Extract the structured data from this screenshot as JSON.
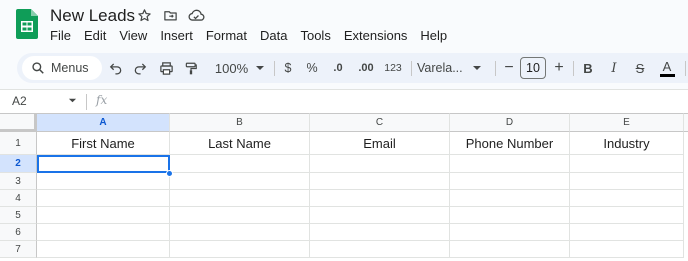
{
  "app": {
    "doc_title": "New Leads",
    "accent_color": "#0f9d58",
    "title_icons": [
      "star-icon",
      "move-to-folder-icon",
      "cloud-status-icon"
    ]
  },
  "menubar": {
    "items": [
      "File",
      "Edit",
      "View",
      "Insert",
      "Format",
      "Data",
      "Tools",
      "Extensions",
      "Help"
    ]
  },
  "toolbar": {
    "menus_label": "Menus",
    "zoom": "100%",
    "currency": "$",
    "percent": "%",
    "decrease_decimal": ".0",
    "increase_decimal": ".00",
    "number_format": "123",
    "font_name": "Varela...",
    "font_size": "10",
    "minus": "−",
    "plus": "+",
    "bold": "B",
    "italic": "I",
    "strikethrough": "S",
    "text_color_letter": "A"
  },
  "formula_bar": {
    "cell_ref": "A2",
    "fx": "fx",
    "value": ""
  },
  "sheet": {
    "columns": [
      "A",
      "B",
      "C",
      "D",
      "E"
    ],
    "rows": [
      "1",
      "2",
      "3",
      "4",
      "5",
      "6",
      "7"
    ],
    "selected_column": "A",
    "selected_row": "2",
    "header_row": [
      "First Name",
      "Last Name",
      "Email",
      "Phone Number",
      "Industry"
    ]
  }
}
